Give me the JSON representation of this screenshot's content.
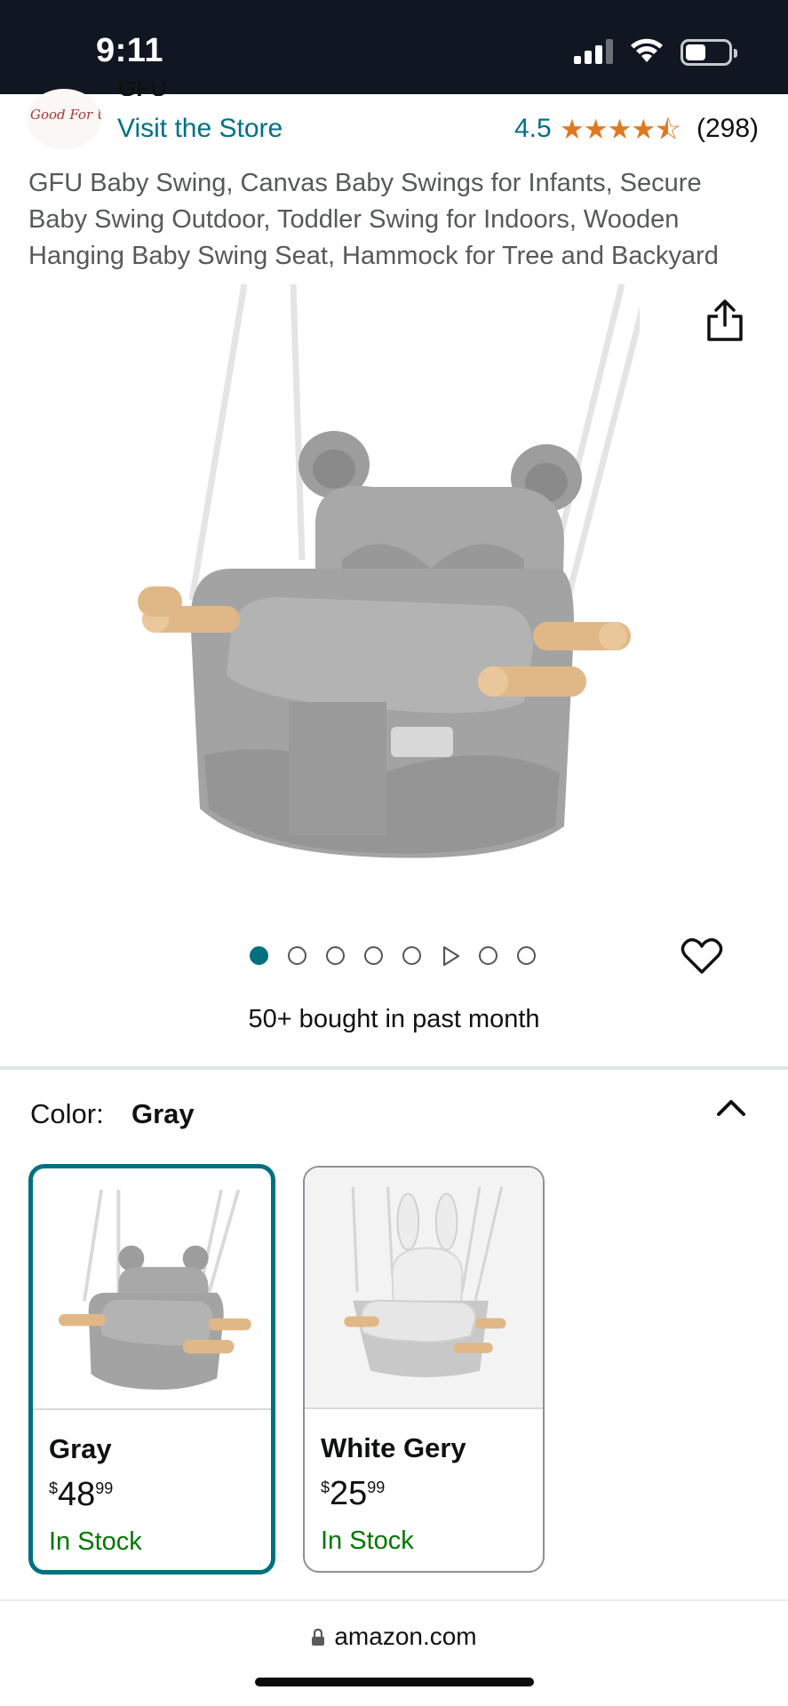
{
  "status_bar": {
    "time": "9:11"
  },
  "brand": {
    "logo_text": "Good For U",
    "name": "GFU",
    "visit_store": "Visit the Store",
    "rating": "4.5",
    "stars": "★★★★⯪",
    "rating_count": "(298)"
  },
  "product": {
    "title": "GFU Baby Swing, Canvas Baby Swings for Infants, Secure Baby Swing Outdoor, Toddler Swing for Indoors, Wooden Hanging Baby Swing Seat, Hammock for Tree and Backyard"
  },
  "carousel": {
    "total_images": 8,
    "active_index": 0,
    "video_index": 5
  },
  "social_proof": "50+ bought in past month",
  "color": {
    "label": "Color:",
    "selected": "Gray",
    "options": [
      {
        "name": "Gray",
        "price_symbol": "$",
        "price_whole": "48",
        "price_fraction": "99",
        "stock": "In Stock",
        "selected": true
      },
      {
        "name": "White Gery",
        "price_symbol": "$",
        "price_whole": "25",
        "price_fraction": "99",
        "stock": "In Stock",
        "selected": false
      }
    ]
  },
  "browser": {
    "url": "amazon.com"
  },
  "colors": {
    "status_bar_bg": "#111722",
    "link": "#007185",
    "star": "#de7921",
    "selected_border": "#00707f",
    "in_stock": "#007600"
  }
}
